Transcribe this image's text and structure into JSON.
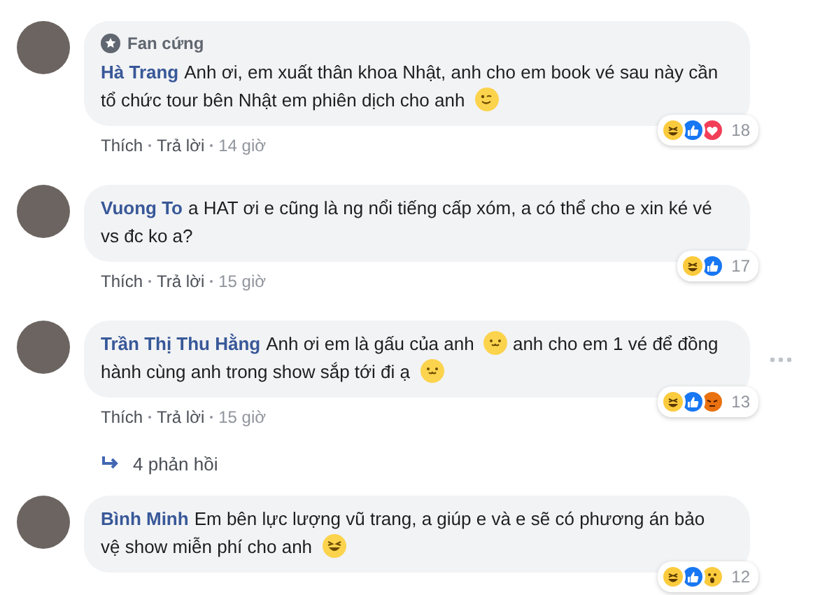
{
  "comments": [
    {
      "author": "Hà Trang",
      "badge": "Fan cứng",
      "body": [
        {
          "kind": "text",
          "text": "Anh ơi, em xuất thân khoa Nhật, anh cho em book vé sau này cần tổ chức tour bên Nhật em phiên dịch cho anh"
        },
        {
          "kind": "wink"
        }
      ],
      "actions": [
        "Thích",
        "Trả lời"
      ],
      "time": "14 giờ",
      "reactions": [
        {
          "kind": "haha"
        },
        {
          "kind": "like"
        },
        {
          "kind": "love"
        }
      ],
      "reaction_count": "18",
      "more": false
    },
    {
      "author": "Vuong To",
      "body": [
        {
          "kind": "text",
          "text": "a HAT ơi e cũng là ng nổi tiếng cấp xóm, a có thể cho e xin ké vé vs đc ko a?"
        }
      ],
      "actions": [
        "Thích",
        "Trả lời"
      ],
      "time": "15 giờ",
      "reactions": [
        {
          "kind": "haha"
        },
        {
          "kind": "like"
        }
      ],
      "reaction_count": "17",
      "more": false
    },
    {
      "author": "Trần Thị Thu Hằng",
      "body": [
        {
          "kind": "text",
          "text": "Anh ơi em là gấu của anh"
        },
        {
          "kind": "smile"
        },
        {
          "kind": "text",
          "text": "anh cho em 1 vé để đồng hành cùng anh trong show sắp tới đi ạ"
        },
        {
          "kind": "smile"
        }
      ],
      "actions": [
        "Thích",
        "Trả lời"
      ],
      "time": "15 giờ",
      "reactions": [
        {
          "kind": "haha"
        },
        {
          "kind": "like"
        },
        {
          "kind": "angry"
        }
      ],
      "reaction_count": "13",
      "more": true,
      "replies": "4 phản hồi"
    },
    {
      "author": "Bình Minh",
      "body": [
        {
          "kind": "text",
          "text": "Em bên lực lượng vũ trang, a giúp e và e sẽ có phương án bảo vệ show miễn phí cho anh"
        },
        {
          "kind": "rofl"
        }
      ],
      "reactions": [
        {
          "kind": "haha"
        },
        {
          "kind": "like"
        },
        {
          "kind": "wow"
        }
      ],
      "reaction_count": "12",
      "more": false
    }
  ]
}
